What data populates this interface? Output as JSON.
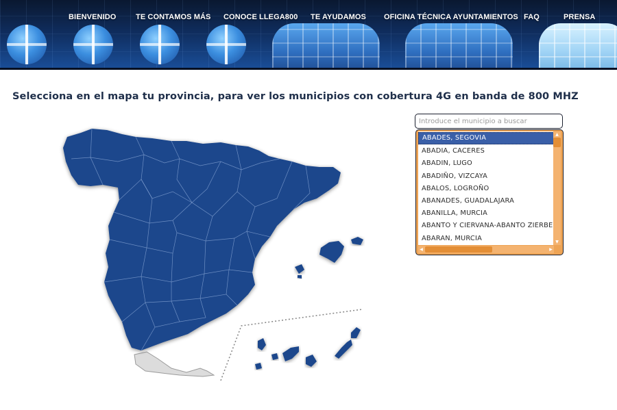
{
  "nav": {
    "items": [
      {
        "label": "BIENVENIDO"
      },
      {
        "label": "TE CONTAMOS MÁS"
      },
      {
        "label": "CONOCE LLEGA800"
      },
      {
        "label": "TE AYUDAMOS"
      },
      {
        "label": "OFICINA TÉCNICA AYUNTAMIENTOS"
      },
      {
        "label": "FAQ"
      },
      {
        "label": "PRENSA"
      }
    ]
  },
  "main": {
    "heading": "Selecciona en el mapa tu provincia, para ver los municipios con cobertura 4G en banda de 800 MHZ"
  },
  "search": {
    "placeholder": "Introduce el municipio a buscar",
    "value": "",
    "results": [
      {
        "label": "ABADES, SEGOVIA",
        "selected": true
      },
      {
        "label": "ABADIA, CACERES"
      },
      {
        "label": "ABADIN, LUGO"
      },
      {
        "label": "ABADIÑO, VIZCAYA"
      },
      {
        "label": "ABALOS, LOGROÑO"
      },
      {
        "label": "ABANADES, GUADALAJARA"
      },
      {
        "label": "ABANILLA, MURCIA"
      },
      {
        "label": "ABANTO Y CIERVANA-ABANTO ZIERBENA"
      },
      {
        "label": "ABARAN, MURCIA"
      }
    ]
  },
  "colors": {
    "map_fill": "#1b468c",
    "list_accent": "#eea455",
    "selected_row": "#3a5fa8",
    "heading_text": "#1f2f4a"
  }
}
